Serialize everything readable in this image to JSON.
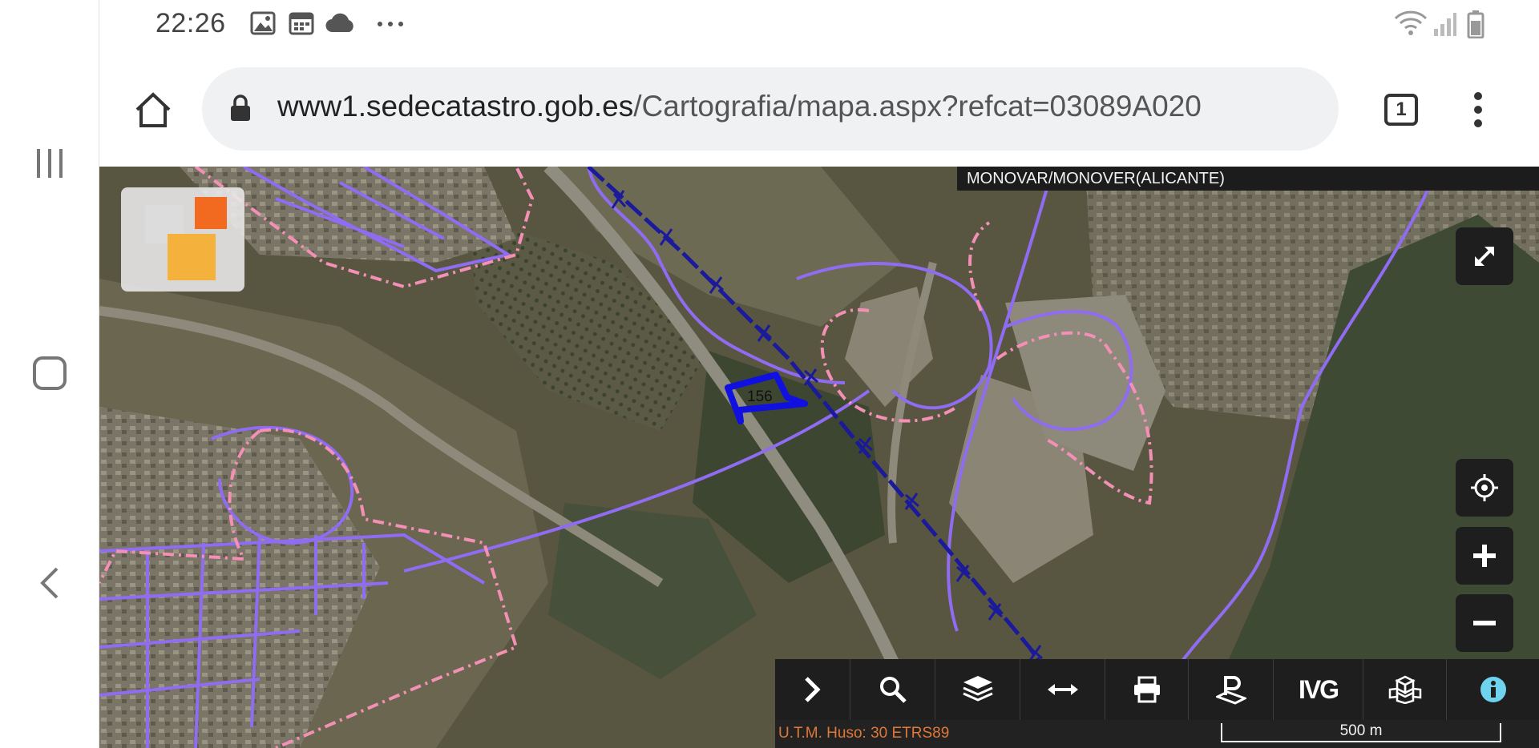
{
  "status_bar": {
    "time": "22:26",
    "left_icons": [
      "image-icon",
      "calendar-icon",
      "cloud-icon",
      "more-icon"
    ],
    "right_icons": [
      "wifi-icon",
      "signal-icon",
      "battery-icon"
    ]
  },
  "browser": {
    "url_domain": "www1.sedecatastro.gob.es",
    "url_path": "/Cartografia/mapa.aspx?refcat=03089A020",
    "tab_count": "1"
  },
  "map": {
    "municipality": "MONOVAR/MONOVER(ALICANTE)",
    "parcel_label": "156",
    "projection": "U.T.M. Huso: 30 ETRS89",
    "scale": "500 m",
    "toolbar": [
      {
        "name": "expand-panel-icon"
      },
      {
        "name": "search-icon"
      },
      {
        "name": "layers-icon"
      },
      {
        "name": "measure-icon"
      },
      {
        "name": "print-icon"
      },
      {
        "name": "parcel-icon"
      },
      {
        "name": "ivg-label",
        "label": "IVG"
      },
      {
        "name": "3d-icon"
      },
      {
        "name": "info-icon"
      }
    ],
    "colors": {
      "boundary": "#8f6cf2",
      "urban_limit": "#f48fb6",
      "railway": "#1a1a9a",
      "parcel": "#1010e0",
      "info_accent": "#6fd3ee",
      "projection_text": "#e07838"
    }
  }
}
